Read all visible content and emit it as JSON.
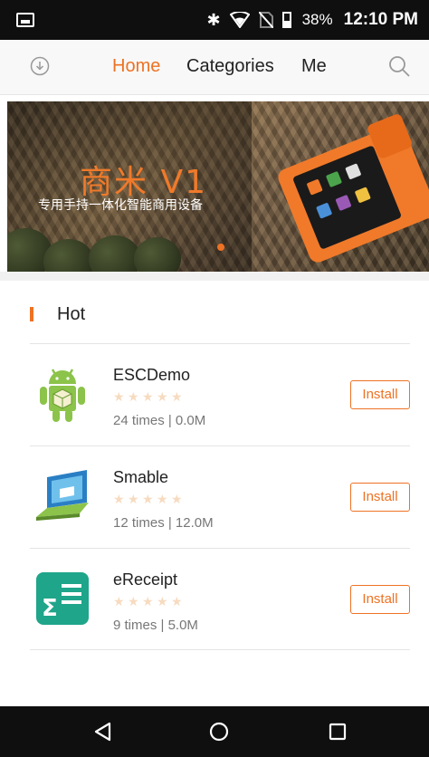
{
  "status_bar": {
    "battery": "38%",
    "time": "12:10 PM",
    "icons": [
      "gallery-icon",
      "bluetooth-icon",
      "wifi-icon",
      "no-sim-icon",
      "battery-icon"
    ]
  },
  "nav": {
    "tabs": [
      {
        "label": "Home",
        "active": true
      },
      {
        "label": "Categories",
        "active": false
      },
      {
        "label": "Me",
        "active": false
      }
    ],
    "accent_color": "#ee7223"
  },
  "banner": {
    "title": "商米 V1",
    "subtitle": "专用手持一体化智能商用设备"
  },
  "hot": {
    "title": "Hot",
    "apps": [
      {
        "name": "ESCDemo",
        "meta": "24 times | 0.0M",
        "install_label": "Install",
        "icon": "android-package-icon",
        "rating": 0
      },
      {
        "name": "Smable",
        "meta": "12 times | 12.0M",
        "install_label": "Install",
        "icon": "laptop-icon",
        "rating": 0
      },
      {
        "name": "eReceipt",
        "meta": "9 times | 5.0M",
        "install_label": "Install",
        "icon": "sigma-document-icon",
        "rating": 0
      }
    ]
  }
}
